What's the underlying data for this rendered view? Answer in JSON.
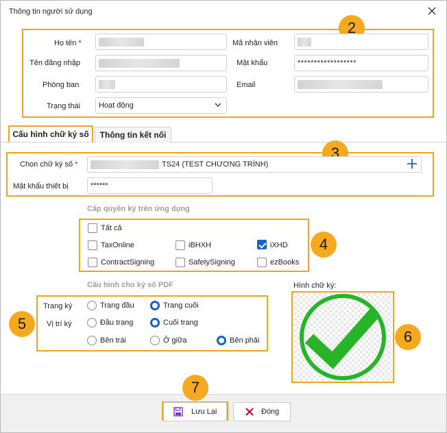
{
  "window": {
    "title": "Thông tin người sử dụng"
  },
  "badges": {
    "b2": "2",
    "b3": "3",
    "b4": "4",
    "b5": "5",
    "b6": "6",
    "b7": "7"
  },
  "user_info": {
    "fullname_label": "Họ tên",
    "required_mark": "*",
    "employee_code_label": "Mã nhân viên",
    "username_label": "Tên đăng nhập",
    "password_label": "Mật khẩu",
    "password_value": "******************",
    "department_label": "Phòng ban",
    "email_label": "Email",
    "status_label": "Trạng thái",
    "status_value": "Hoạt động"
  },
  "tabs": [
    {
      "label": "Cấu hình chữ ký số",
      "active": true
    },
    {
      "label": "Thông tin kết nối",
      "active": false
    }
  ],
  "signature_config": {
    "select_label": "Chọn chữ ký số",
    "required_mark": "*",
    "select_value_suffix": "TS24 (TEST CHƯƠNG TRÌNH)",
    "device_password_label": "Mật khẩu thiết bị",
    "device_password_value": "******"
  },
  "app_permissions": {
    "title": "Cấp quyền ký trên ứng dụng",
    "options": [
      {
        "label": "Tất cả",
        "checked": false
      },
      {
        "label": "TaxOnline",
        "checked": false
      },
      {
        "label": "iBHXH",
        "checked": false
      },
      {
        "label": "iXHD",
        "checked": true
      },
      {
        "label": "ContractSigning",
        "checked": false
      },
      {
        "label": "SafetySigning",
        "checked": false
      },
      {
        "label": "ezBooks",
        "checked": false
      }
    ]
  },
  "pdf_config": {
    "title": "Cấu hình cho ký số PDF",
    "page_label": "Trang ký",
    "position_label": "Vị trí ký",
    "page_options": [
      {
        "label": "Trang đầu",
        "selected": false
      },
      {
        "label": "Trang cuối",
        "selected": true
      }
    ],
    "vertical_options": [
      {
        "label": "Đầu trang",
        "selected": false
      },
      {
        "label": "Cuối trang",
        "selected": true
      }
    ],
    "horizontal_options": [
      {
        "label": "Bên trái",
        "selected": false
      },
      {
        "label": "Ở giữa",
        "selected": false
      },
      {
        "label": "Bên phải",
        "selected": true
      }
    ]
  },
  "signature_image": {
    "label": "Hình chữ ký:",
    "check_color": "#28b428"
  },
  "footer": {
    "save_label": "Lưu Lại",
    "close_label": "Đóng"
  },
  "colors": {
    "accent": "#f2a21c",
    "primary": "#1464c8",
    "danger": "#d0021b"
  }
}
